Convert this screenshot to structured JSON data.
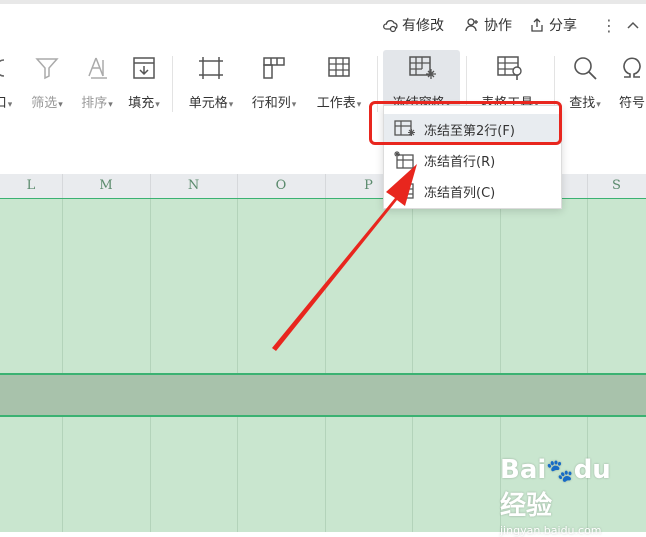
{
  "topbar": {
    "has_changes_label": "有修改",
    "collaborate_label": "协作",
    "share_label": "分享",
    "more_icon": "kebab-icon",
    "collapse_icon": "chevron-up-icon"
  },
  "ribbon": {
    "items": [
      {
        "label": "口",
        "icon": "format-icon"
      },
      {
        "label": "筛选",
        "icon": "filter-icon"
      },
      {
        "label": "排序",
        "icon": "sort-icon"
      },
      {
        "label": "填充",
        "icon": "fill-icon"
      },
      {
        "label": "单元格",
        "icon": "cell-icon"
      },
      {
        "label": "行和列",
        "icon": "rows-cols-icon"
      },
      {
        "label": "工作表",
        "icon": "worksheet-icon"
      },
      {
        "label": "冻结窗格",
        "icon": "freeze-panes-icon"
      },
      {
        "label": "表格工具",
        "icon": "table-tools-icon"
      },
      {
        "label": "查找",
        "icon": "search-icon"
      },
      {
        "label": "符号",
        "icon": "omega-icon"
      }
    ]
  },
  "columns": [
    "L",
    "M",
    "N",
    "O",
    "P",
    "S"
  ],
  "freeze_menu": {
    "items": [
      {
        "label": "冻结至第2行(F)",
        "icon": "freeze-to-row-icon"
      },
      {
        "label": "冻结首行(R)",
        "icon": "freeze-first-row-icon"
      },
      {
        "label": "冻结首列(C)",
        "icon": "freeze-first-column-icon"
      }
    ]
  },
  "colors": {
    "accent_green": "#3bb272",
    "grid_green": "#c9e6cf",
    "highlight_red": "#e8261e"
  },
  "watermark": {
    "logo": "Bai du 经验",
    "url": "jingyan.baidu.com"
  }
}
